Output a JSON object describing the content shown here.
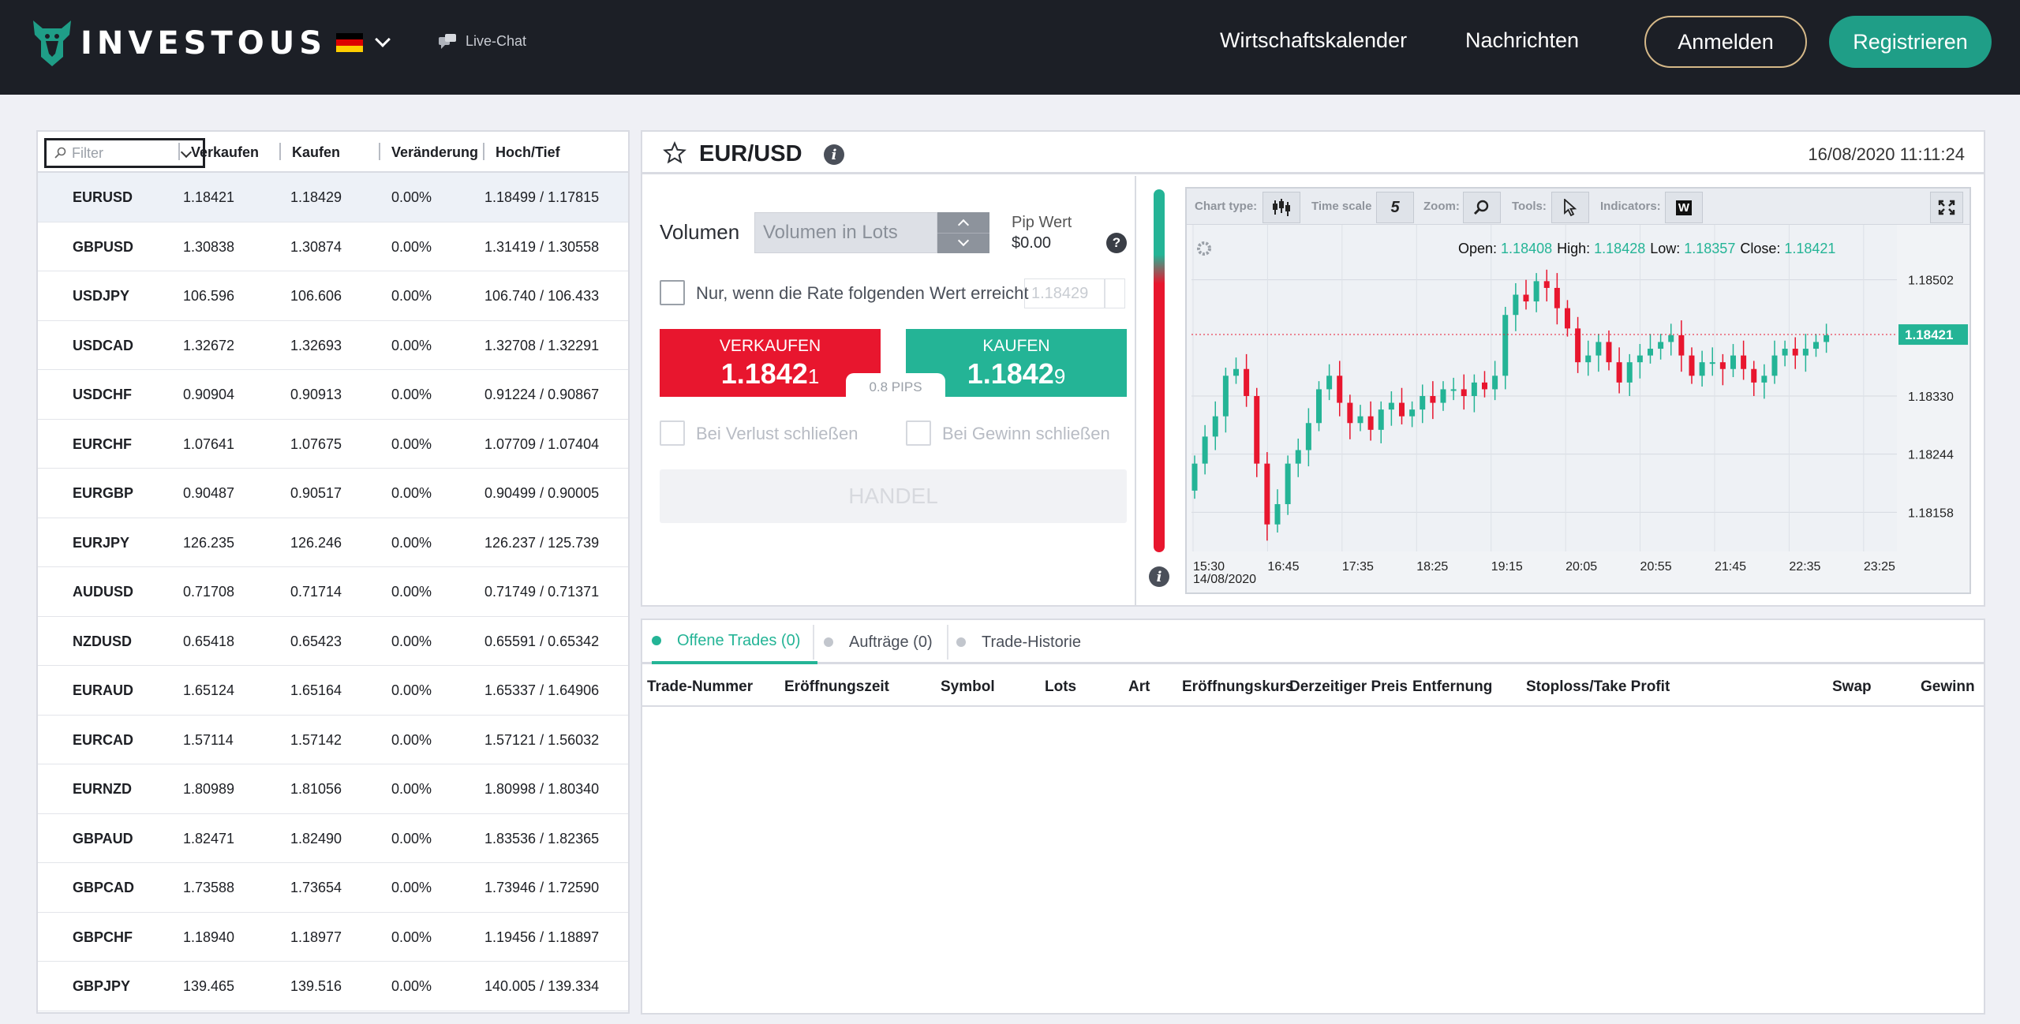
{
  "header": {
    "brand": "INVESTOUS",
    "live_chat": "Live-Chat",
    "nav": [
      "Wirtschaftskalender",
      "Nachrichten"
    ],
    "login": "Anmelden",
    "register": "Registrieren",
    "colors": {
      "accent": "#1f9e87",
      "login_border": "#d5b888"
    }
  },
  "watchlist": {
    "filter_placeholder": "Filter",
    "columns": [
      "Verkaufen",
      "Kaufen",
      "Veränderung",
      "Hoch/Tief"
    ],
    "rows": [
      {
        "symbol": "EURUSD",
        "sell": "1.18421",
        "buy": "1.18429",
        "change": "0.00%",
        "hl": "1.18499 / 1.17815"
      },
      {
        "symbol": "GBPUSD",
        "sell": "1.30838",
        "buy": "1.30874",
        "change": "0.00%",
        "hl": "1.31419 / 1.30558"
      },
      {
        "symbol": "USDJPY",
        "sell": "106.596",
        "buy": "106.606",
        "change": "0.00%",
        "hl": "106.740 / 106.433"
      },
      {
        "symbol": "USDCAD",
        "sell": "1.32672",
        "buy": "1.32693",
        "change": "0.00%",
        "hl": "1.32708 / 1.32291"
      },
      {
        "symbol": "USDCHF",
        "sell": "0.90904",
        "buy": "0.90913",
        "change": "0.00%",
        "hl": "0.91224 / 0.90867"
      },
      {
        "symbol": "EURCHF",
        "sell": "1.07641",
        "buy": "1.07675",
        "change": "0.00%",
        "hl": "1.07709 / 1.07404"
      },
      {
        "symbol": "EURGBP",
        "sell": "0.90487",
        "buy": "0.90517",
        "change": "0.00%",
        "hl": "0.90499 / 0.90005"
      },
      {
        "symbol": "EURJPY",
        "sell": "126.235",
        "buy": "126.246",
        "change": "0.00%",
        "hl": "126.237 / 125.739"
      },
      {
        "symbol": "AUDUSD",
        "sell": "0.71708",
        "buy": "0.71714",
        "change": "0.00%",
        "hl": "0.71749 / 0.71371"
      },
      {
        "symbol": "NZDUSD",
        "sell": "0.65418",
        "buy": "0.65423",
        "change": "0.00%",
        "hl": "0.65591 / 0.65342"
      },
      {
        "symbol": "EURAUD",
        "sell": "1.65124",
        "buy": "1.65164",
        "change": "0.00%",
        "hl": "1.65337 / 1.64906"
      },
      {
        "symbol": "EURCAD",
        "sell": "1.57114",
        "buy": "1.57142",
        "change": "0.00%",
        "hl": "1.57121 / 1.56032"
      },
      {
        "symbol": "EURNZD",
        "sell": "1.80989",
        "buy": "1.81056",
        "change": "0.00%",
        "hl": "1.80998 / 1.80340"
      },
      {
        "symbol": "GBPAUD",
        "sell": "1.82471",
        "buy": "1.82490",
        "change": "0.00%",
        "hl": "1.83536 / 1.82365"
      },
      {
        "symbol": "GBPCAD",
        "sell": "1.73588",
        "buy": "1.73654",
        "change": "0.00%",
        "hl": "1.73946 / 1.72590"
      },
      {
        "symbol": "GBPCHF",
        "sell": "1.18940",
        "buy": "1.18977",
        "change": "0.00%",
        "hl": "1.19456 / 1.18897"
      },
      {
        "symbol": "GBPJPY",
        "sell": "139.465",
        "buy": "139.516",
        "change": "0.00%",
        "hl": "140.005 / 139.334"
      }
    ]
  },
  "trade": {
    "pair": "EUR/USD",
    "datetime": "16/08/2020 11:11:24",
    "volume_label": "Volumen",
    "volume_placeholder": "Volumen in Lots",
    "pip_label": "Pip Wert",
    "pip_value": "$0.00",
    "help": "?",
    "rate_condition": "Nur, wenn die Rate folgenden Wert erreicht",
    "rate_value": "1.18429",
    "sell_label": "VERKAUFEN",
    "sell_price_main": "1.1842",
    "sell_price_last": "1",
    "buy_label": "KAUFEN",
    "buy_price_main": "1.1842",
    "buy_price_last": "9",
    "spread": "0.8 PIPS",
    "stop_loss": "Bei Verlust schließen",
    "take_profit": "Bei Gewinn schließen",
    "submit": "HANDEL",
    "sentiment_buy_fraction": 0.18
  },
  "chart_toolbar": {
    "chart_type": "Chart type:",
    "time_scale": "Time scale",
    "time_scale_value": "5",
    "zoom": "Zoom:",
    "tools": "Tools:",
    "indicators": "Indicators:",
    "indicators_icon": "W"
  },
  "chart_data": {
    "type": "candlestick",
    "ohlc_label": {
      "open_l": "Open:",
      "open": "1.18408",
      "high_l": "High:",
      "high": "1.18428",
      "low_l": "Low:",
      "low": "1.18357",
      "close_l": "Close:",
      "close": "1.18421"
    },
    "current_price": "1.18421",
    "current_price_value": 1.18421,
    "y_ticks": [
      1.18502,
      1.1833,
      1.18244,
      1.18158
    ],
    "y_tick_labels": [
      "1.18502",
      "1.18330",
      "1.18244",
      "1.18158"
    ],
    "x_tick_labels": [
      "15:30",
      "16:45",
      "17:35",
      "18:25",
      "19:15",
      "20:05",
      "20:55",
      "21:45",
      "22:35",
      "23:25"
    ],
    "x_date": "14/08/2020",
    "ylim": [
      1.181,
      1.1856
    ],
    "closes": [
      1.1823,
      1.1827,
      1.183,
      1.1836,
      1.1837,
      1.1833,
      1.1823,
      1.1814,
      1.1817,
      1.1823,
      1.1825,
      1.1829,
      1.1834,
      1.1836,
      1.1832,
      1.1829,
      1.183,
      1.1828,
      1.1831,
      1.1832,
      1.183,
      1.1831,
      1.1833,
      1.1832,
      1.1834,
      1.1834,
      1.1833,
      1.1835,
      1.1834,
      1.1836,
      1.1845,
      1.1848,
      1.1847,
      1.185,
      1.1849,
      1.1846,
      1.1843,
      1.1838,
      1.1839,
      1.1841,
      1.1838,
      1.1835,
      1.1838,
      1.1839,
      1.184,
      1.1841,
      1.1842,
      1.1839,
      1.1836,
      1.1838,
      1.1838,
      1.1837,
      1.1839,
      1.1837,
      1.1835,
      1.1836,
      1.1839,
      1.184,
      1.1839,
      1.184,
      1.1841,
      1.1842
    ]
  },
  "history": {
    "tabs": [
      "Offene Trades (0)",
      "Aufträge (0)",
      "Trade-Historie"
    ],
    "columns": [
      "Trade-Nummer",
      "Eröffnungszeit",
      "Symbol",
      "Lots",
      "Art",
      "Eröffnungskurs",
      "Derzeitiger Preis",
      "Entfernung",
      "Stoploss/Take Profit",
      "Swap",
      "Gewinn"
    ]
  }
}
